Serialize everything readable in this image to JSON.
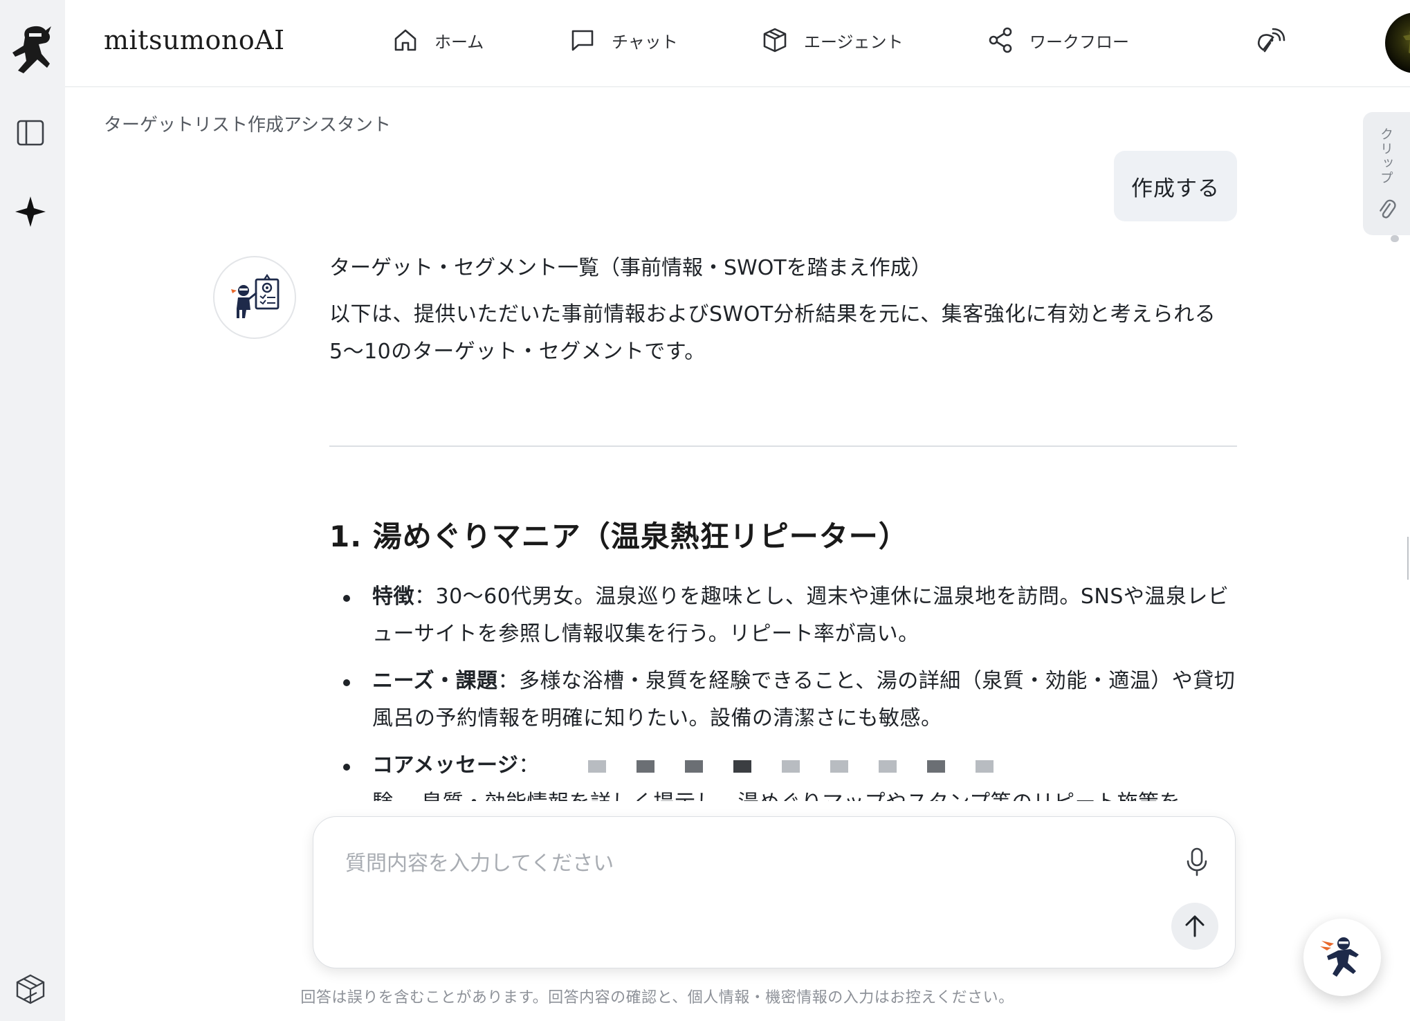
{
  "app": {
    "brand": "mitsumonoAI"
  },
  "nav": {
    "home": "ホーム",
    "chat": "チャット",
    "agent": "エージェント",
    "workflow": "ワークフロー"
  },
  "breadcrumb": "ターゲットリスト作成アシスタント",
  "clip_tab_label": "クリップ",
  "user_message": "作成する",
  "assistant": {
    "title": "ターゲット・セグメント一覧（事前情報・SWOTを踏まえ作成）",
    "intro": "以下は、提供いただいた事前情報およびSWOT分析結果を元に、集客強化に有効と考えられる5〜10のターゲット・セグメントです。",
    "section_heading": "1. 湯めぐりマニア（温泉熱狂リピーター）",
    "items": [
      {
        "label": "特徴",
        "text": "：30〜60代男女。温泉巡りを趣味とし、週末や連休に温泉地を訪問。SNSや温泉レビューサイトを参照し情報収集を行う。リピート率が高い。"
      },
      {
        "label": "ニーズ・課題",
        "text": "：多様な浴槽・泉質を経験できること、湯の詳細（泉質・効能・適温）や貸切風呂の予約情報を明確に知りたい。設備の清潔さにも敏感。"
      },
      {
        "label": "コアメッセージ",
        "text": "：",
        "continuation": "験。 泉質・効能情報を詳しく提示し、湯めぐりマップやスタンプ等のリピート施策を"
      }
    ]
  },
  "composer": {
    "placeholder": "質問内容を入力してください"
  },
  "disclaimer": "回答は誤りを含むことがあります。回答内容の確認と、個人情報・機密情報の入力はお控えください。",
  "icons": {
    "logo": "ninja-logo-icon",
    "sidebar_toggle": "sidebar-toggle-icon",
    "sparkle": "sparkle-icon",
    "cube": "cube-icon",
    "home": "home-icon",
    "chat": "chat-bubble-icon",
    "agent": "box-icon",
    "workflow": "share-nodes-icon",
    "wireless": "satellite-icon",
    "paperclip": "paperclip-icon",
    "mic": "microphone-icon",
    "send": "arrow-up-icon",
    "bot": "ninja-presenter-icon"
  }
}
